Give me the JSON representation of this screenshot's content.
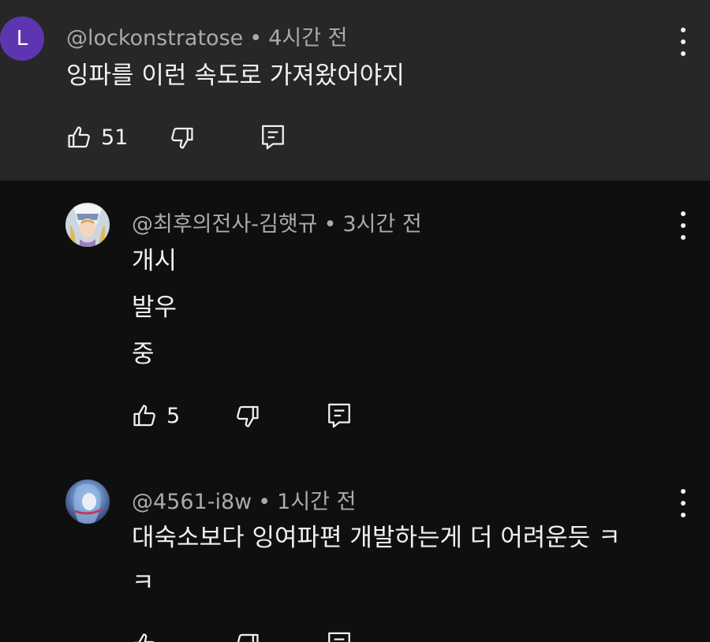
{
  "comments": [
    {
      "avatar_letter": "L",
      "avatar_color": "#5e35b1",
      "handle": "@lockonstratose",
      "separator": "•",
      "time": "4시간 전",
      "lines": [
        "잉파를 이런 속도로 가져왔어야지"
      ],
      "likes": "51"
    },
    {
      "handle": "@최후의전사-김햇규",
      "separator": "•",
      "time": "3시간 전",
      "lines": [
        "개시",
        "발우",
        "중"
      ],
      "likes": "5"
    },
    {
      "handle": "@4561-i8w",
      "separator": "•",
      "time": "1시간 전",
      "lines": [
        "대숙소보다 잉여파편 개발하는게 더 어려운듯 ㅋ",
        "ㅋ"
      ]
    }
  ],
  "icons": {
    "like": "thumbs-up-icon",
    "dislike": "thumbs-down-icon",
    "reply": "reply-icon",
    "more": "more-vert-icon"
  },
  "colors": {
    "background": "#0f0f0f",
    "highlight_background": "#272727",
    "meta_text": "#aaaaaa",
    "body_text": "#f1f1f1"
  }
}
